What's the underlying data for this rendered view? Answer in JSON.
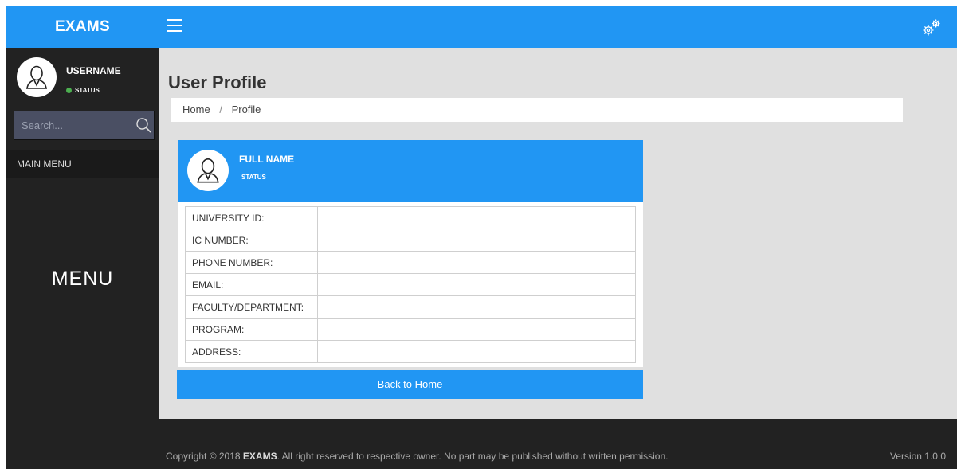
{
  "topbar": {
    "brand": "EXAMS",
    "menu_icon": "hamburger-icon",
    "settings_icon": "gears-icon",
    "accent_color": "#2196f3"
  },
  "sidebar": {
    "username": "USERNAME",
    "status": "STATUS",
    "status_color": "#4caf50",
    "search_placeholder": "Search...",
    "menu_header": "MAIN MENU",
    "menu_label": "MENU"
  },
  "main": {
    "title": "User Profile",
    "breadcrumb": [
      "Home",
      "Profile"
    ],
    "profile": {
      "full_name": "FULL NAME",
      "status": "STATUS",
      "fields": [
        {
          "label": "UNIVERSITY ID:",
          "value": ""
        },
        {
          "label": "IC NUMBER:",
          "value": ""
        },
        {
          "label": "PHONE NUMBER:",
          "value": ""
        },
        {
          "label": "EMAIL:",
          "value": ""
        },
        {
          "label": "FACULTY/DEPARTMENT:",
          "value": ""
        },
        {
          "label": "PROGRAM:",
          "value": ""
        },
        {
          "label": "ADDRESS:",
          "value": ""
        }
      ]
    },
    "back_button": "Back to Home"
  },
  "footer": {
    "copyright_prefix": "Copyright © 2018 ",
    "copyright_brand": "EXAMS",
    "copyright_suffix": ". All right reserved to respective owner. No part may be published without written permission.",
    "version": "Version 1.0.0"
  }
}
